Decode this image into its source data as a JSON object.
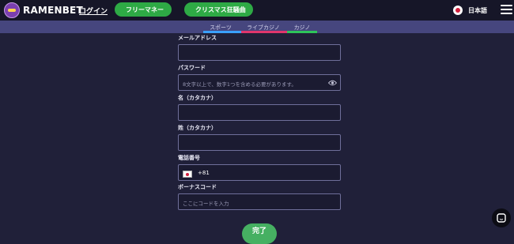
{
  "header": {
    "brand": "RAMENBET",
    "login_label": "ログイン",
    "free_money_label": "フリーマネー",
    "xmas_label": "クリスマス狂騒曲",
    "language_label": "日本語"
  },
  "subnav": {
    "tabs": [
      {
        "label": "スポーツ",
        "color": "#3aa0ff"
      },
      {
        "label": "ライブカジノ",
        "color": "#e0366d"
      },
      {
        "label": "カジノ",
        "color": "#2ec45a"
      }
    ]
  },
  "form": {
    "email": {
      "label": "メールアドレス",
      "value": "",
      "placeholder": ""
    },
    "password": {
      "label": "パスワード",
      "value": "",
      "placeholder": "8文字以上で、数字1つを含める必要があります。"
    },
    "first_name": {
      "label": "名（カタカナ）",
      "value": "",
      "placeholder": ""
    },
    "last_name": {
      "label": "姓（カタカナ）",
      "value": "",
      "placeholder": ""
    },
    "phone": {
      "label": "電話番号",
      "country_code": "+81",
      "value": ""
    },
    "bonus_code": {
      "label": "ボーナスコード",
      "value": "",
      "placeholder": "ここにコードを入力"
    },
    "submit_label": "完了"
  },
  "colors": {
    "accent_green": "#2eaa45",
    "background": "#202039",
    "header": "#161628",
    "subnav": "#46467e"
  }
}
